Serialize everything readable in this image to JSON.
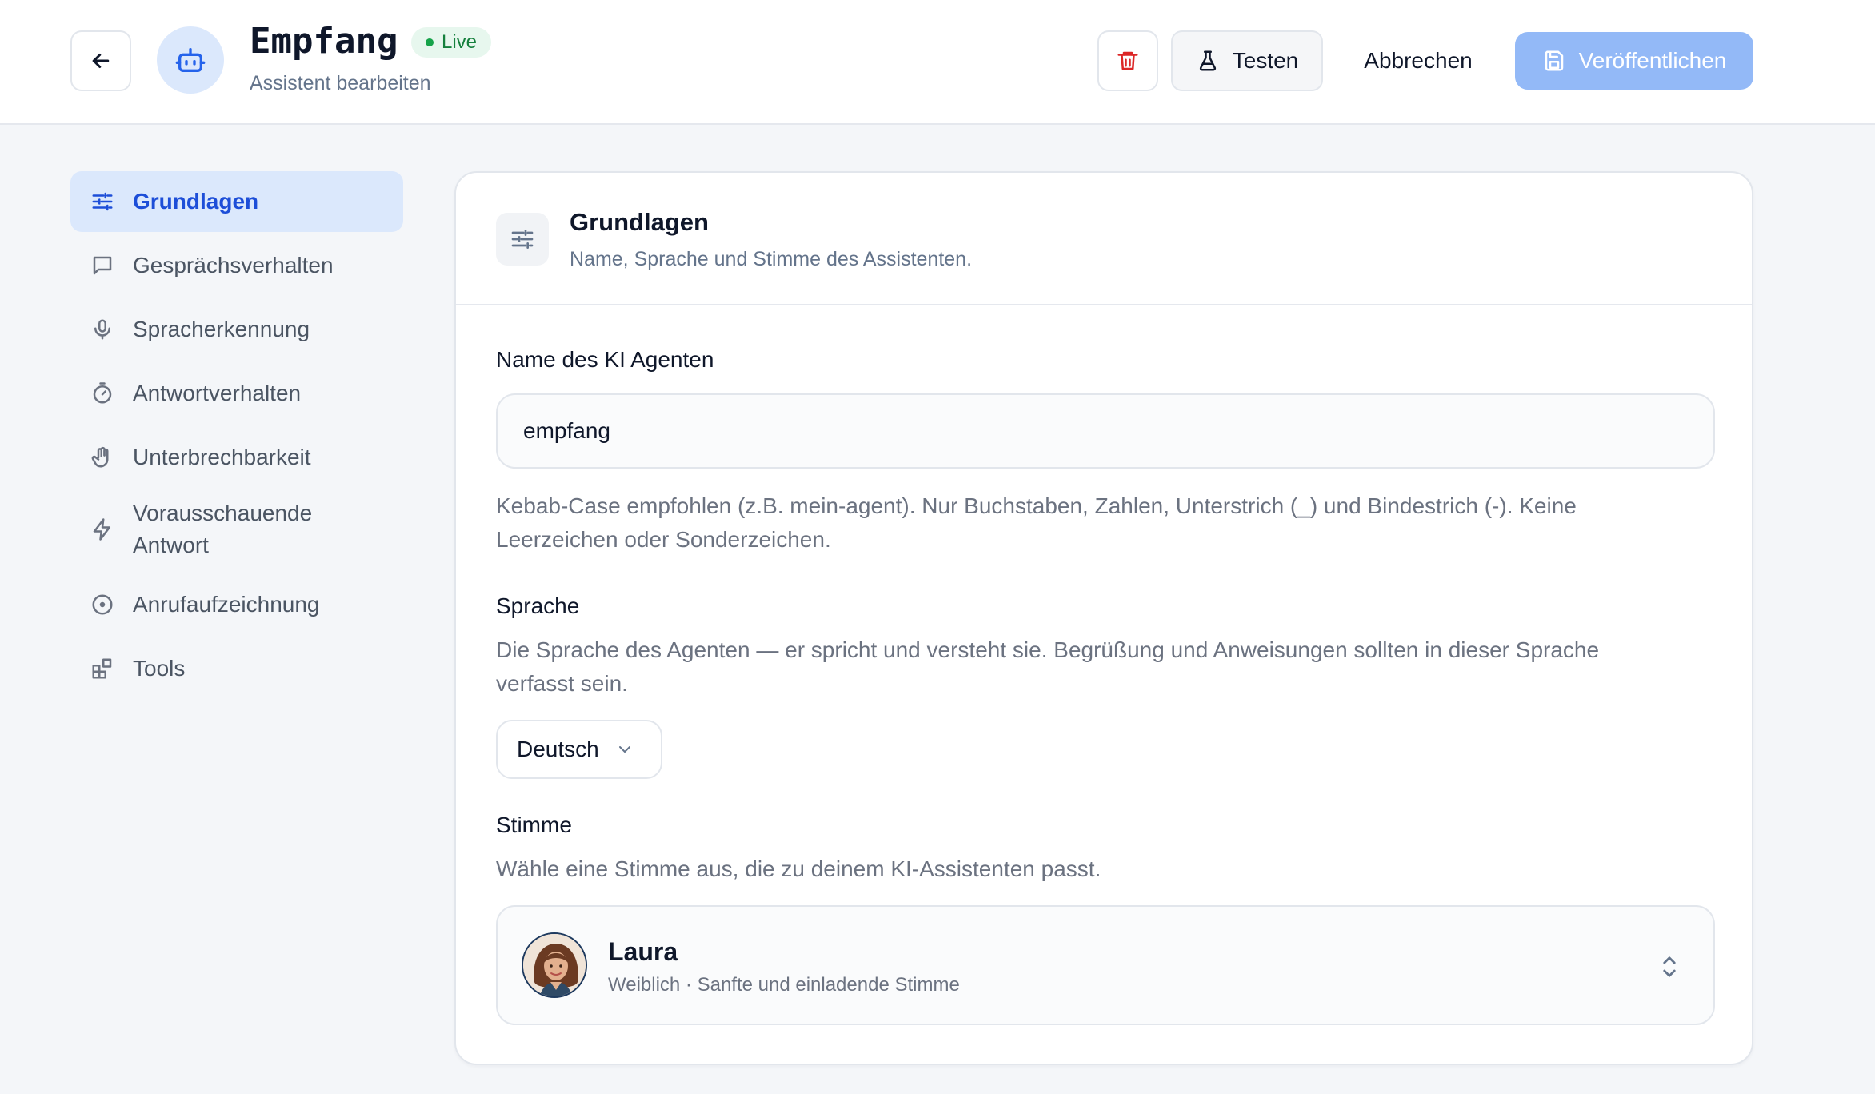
{
  "header": {
    "title": "Empfang",
    "status": "Live",
    "subtitle": "Assistent bearbeiten",
    "test_label": "Testen",
    "cancel_label": "Abbrechen",
    "publish_label": "Veröffentlichen"
  },
  "sidebar": {
    "items": [
      {
        "label": "Grundlagen",
        "icon": "sliders-icon",
        "active": true
      },
      {
        "label": "Gesprächsverhalten",
        "icon": "chat-icon"
      },
      {
        "label": "Spracherkennung",
        "icon": "microphone-icon"
      },
      {
        "label": "Antwortverhalten",
        "icon": "timer-icon"
      },
      {
        "label": "Unterbrechbarkeit",
        "icon": "hand-icon"
      },
      {
        "label": "Vorausschauende Antwort",
        "icon": "lightning-icon"
      },
      {
        "label": "Anrufaufzeichnung",
        "icon": "record-icon"
      },
      {
        "label": "Tools",
        "icon": "blocks-icon"
      }
    ]
  },
  "card": {
    "title": "Grundlagen",
    "subtitle": "Name, Sprache und Stimme des Assistenten.",
    "name_label": "Name des KI Agenten",
    "name_value": "empfang",
    "name_help": "Kebab-Case empfohlen (z.B. mein-agent). Nur Buchstaben, Zahlen, Unterstrich (_) und Bindestrich (-). Keine Leerzeichen oder Sonderzeichen.",
    "language_label": "Sprache",
    "language_help": "Die Sprache des Agenten — er spricht und versteht sie. Begrüßung und Anweisungen sollten in dieser Sprache verfasst sein.",
    "language_value": "Deutsch",
    "voice_label": "Stimme",
    "voice_help": "Wähle eine Stimme aus, die zu deinem KI-Assistenten passt.",
    "voice_name": "Laura",
    "voice_desc": "Weiblich · Sanfte und einladende Stimme"
  },
  "colors": {
    "accent": "#1d4ed8",
    "active_bg": "#dbe8fc",
    "publish_bg": "#93b9f7",
    "live_green": "#16a34a",
    "danger": "#dc2626"
  }
}
